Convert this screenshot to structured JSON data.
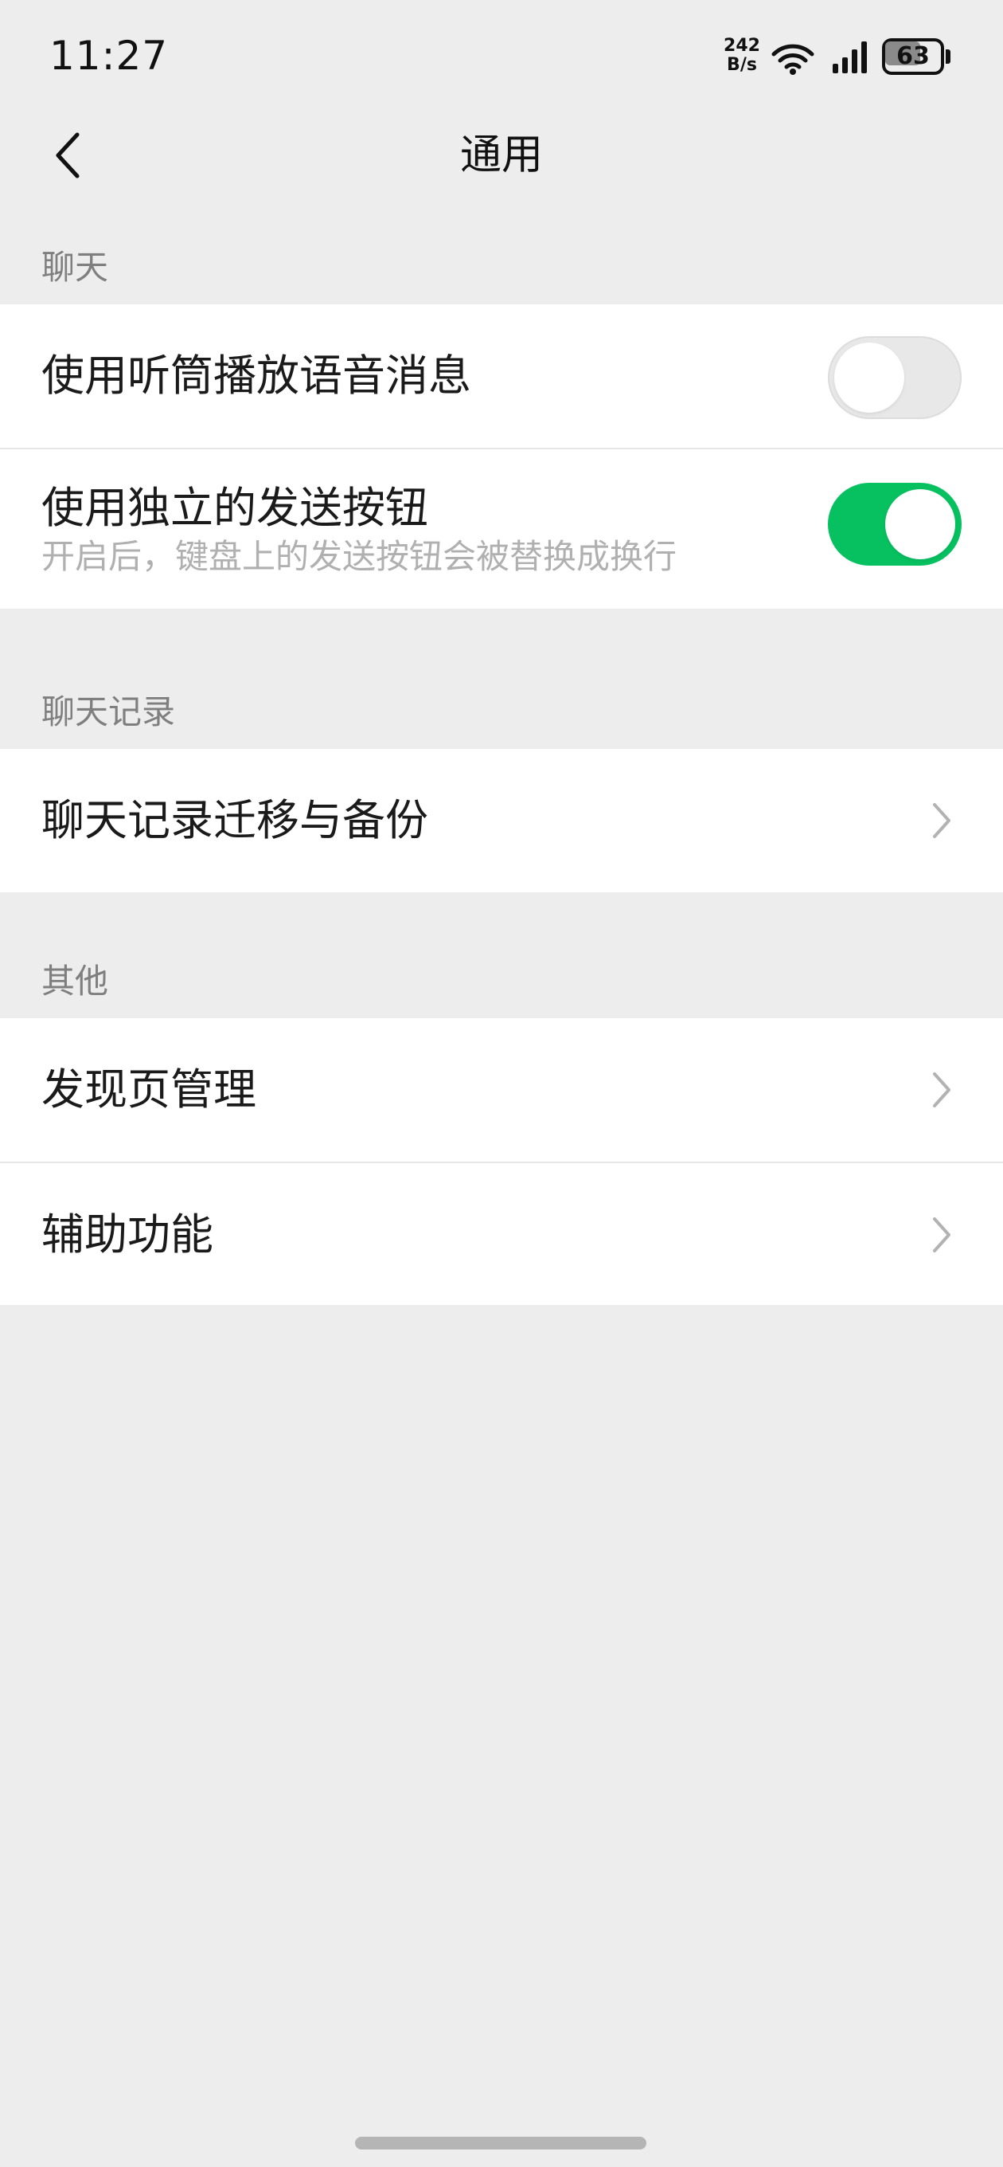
{
  "status_bar": {
    "time": "11:27",
    "net_speed_value": "242",
    "net_speed_unit": "B/s",
    "wifi_icon": "wifi-icon",
    "signal_icon": "cell-signal-icon",
    "battery_level": "63"
  },
  "nav": {
    "back_icon": "chevron-left-icon",
    "title": "通用"
  },
  "sections": {
    "chat": {
      "header": "聊天",
      "items": [
        {
          "title": "使用听筒播放语音消息",
          "toggle_on": false
        },
        {
          "title": "使用独立的发送按钮",
          "description": "开启后，键盘上的发送按钮会被替换成换行",
          "toggle_on": true
        }
      ]
    },
    "chat_history": {
      "header": "聊天记录",
      "items": [
        {
          "title": "聊天记录迁移与备份",
          "icon": "chevron-right-icon"
        }
      ]
    },
    "other": {
      "header": "其他",
      "items": [
        {
          "title": "发现页管理",
          "icon": "chevron-right-icon"
        },
        {
          "title": "辅助功能",
          "icon": "chevron-right-icon"
        }
      ]
    }
  },
  "colors": {
    "background": "#ededed",
    "toggle_on": "#07c160",
    "toggle_off": "#e8e8e8",
    "section_header": "#7f7f7f",
    "description": "#b0b0b0"
  }
}
